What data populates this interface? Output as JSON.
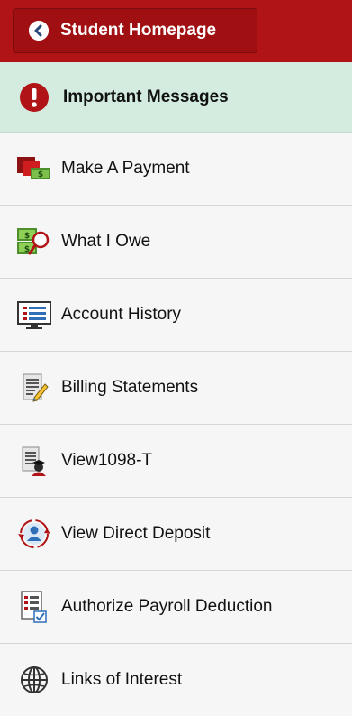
{
  "header": {
    "home_button_label": "Student Homepage",
    "background_color": "#b11416"
  },
  "menu": {
    "items": [
      {
        "label": "Important Messages",
        "icon": "alert-icon",
        "highlight_color": "#d3ecdf"
      },
      {
        "label": "Make A Payment",
        "icon": "payment-icon"
      },
      {
        "label": "What I Owe",
        "icon": "money-magnifier-icon"
      },
      {
        "label": "Account History",
        "icon": "monitor-list-icon"
      },
      {
        "label": "Billing Statements",
        "icon": "document-pencil-icon"
      },
      {
        "label": "View1098-T",
        "icon": "document-graduate-icon"
      },
      {
        "label": "View Direct Deposit",
        "icon": "person-cycle-icon"
      },
      {
        "label": "Authorize Payroll Deduction",
        "icon": "checklist-icon"
      },
      {
        "label": "Links of Interest",
        "icon": "globe-icon"
      }
    ]
  }
}
